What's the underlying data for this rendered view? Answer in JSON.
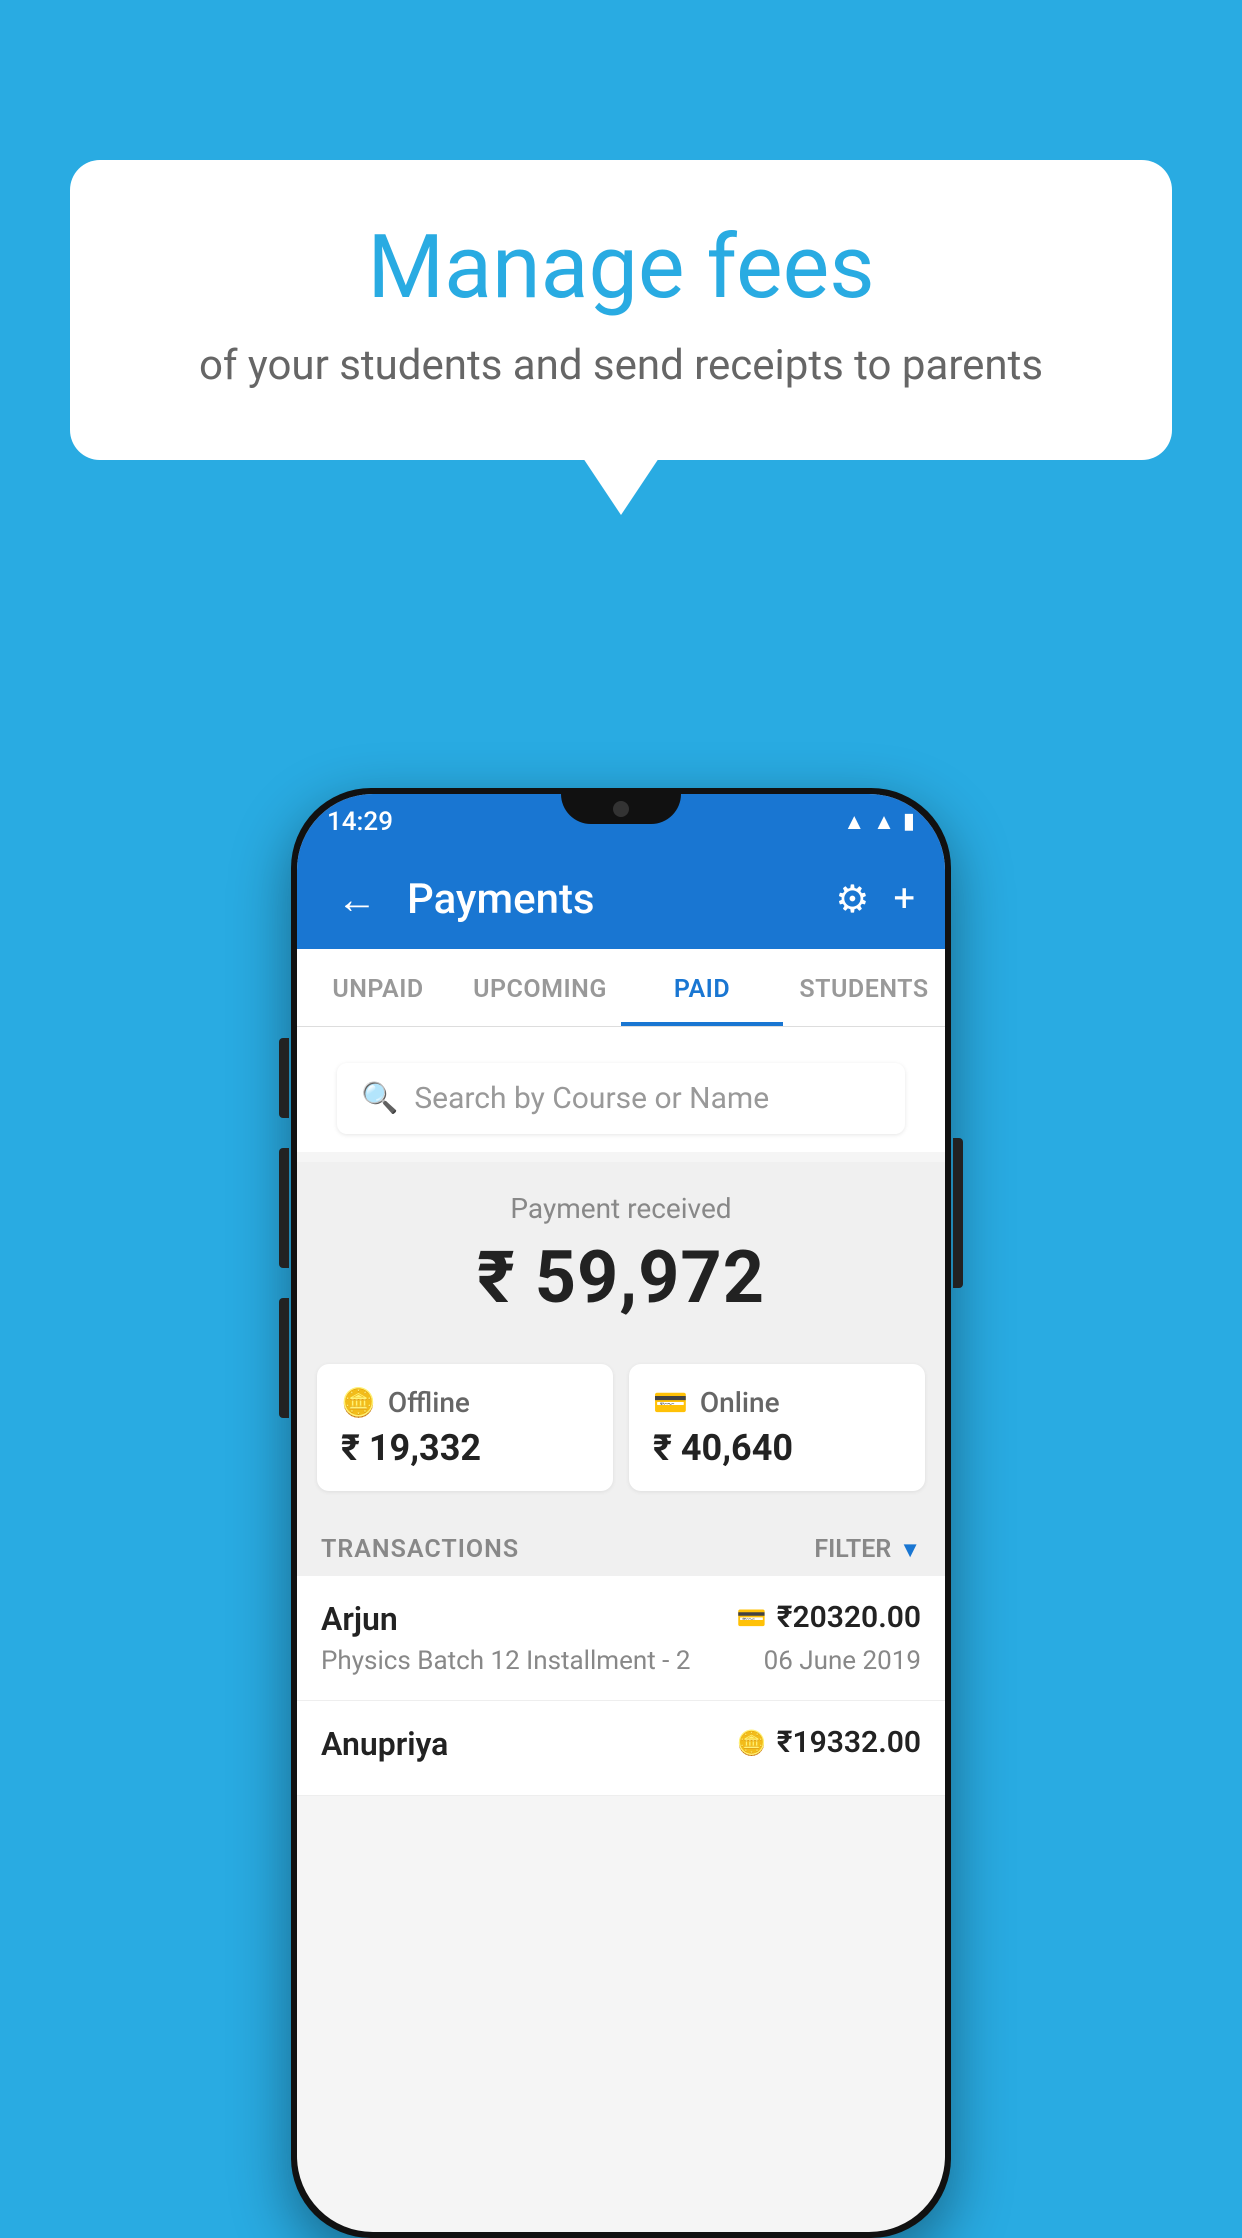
{
  "background_color": "#29ABE2",
  "speech_bubble": {
    "title": "Manage fees",
    "subtitle": "of your students and send receipts to parents"
  },
  "phone": {
    "status_bar": {
      "time": "14:29",
      "icons": [
        "wifi",
        "signal",
        "battery"
      ]
    },
    "app_bar": {
      "title": "Payments",
      "back_label": "←",
      "settings_label": "⚙",
      "add_label": "+"
    },
    "tabs": [
      {
        "label": "UNPAID",
        "active": false
      },
      {
        "label": "UPCOMING",
        "active": false
      },
      {
        "label": "PAID",
        "active": true
      },
      {
        "label": "STUDENTS",
        "active": false
      }
    ],
    "search": {
      "placeholder": "Search by Course or Name"
    },
    "payment_section": {
      "label": "Payment received",
      "amount": "₹ 59,972",
      "offline": {
        "label": "Offline",
        "amount": "₹ 19,332"
      },
      "online": {
        "label": "Online",
        "amount": "₹ 40,640"
      }
    },
    "transactions": {
      "header": "TRANSACTIONS",
      "filter": "FILTER",
      "rows": [
        {
          "name": "Arjun",
          "course": "Physics Batch 12 Installment - 2",
          "amount": "₹20320.00",
          "date": "06 June 2019",
          "payment_type": "online"
        },
        {
          "name": "Anupriya",
          "course": "",
          "amount": "₹19332.00",
          "date": "",
          "payment_type": "offline"
        }
      ]
    }
  }
}
